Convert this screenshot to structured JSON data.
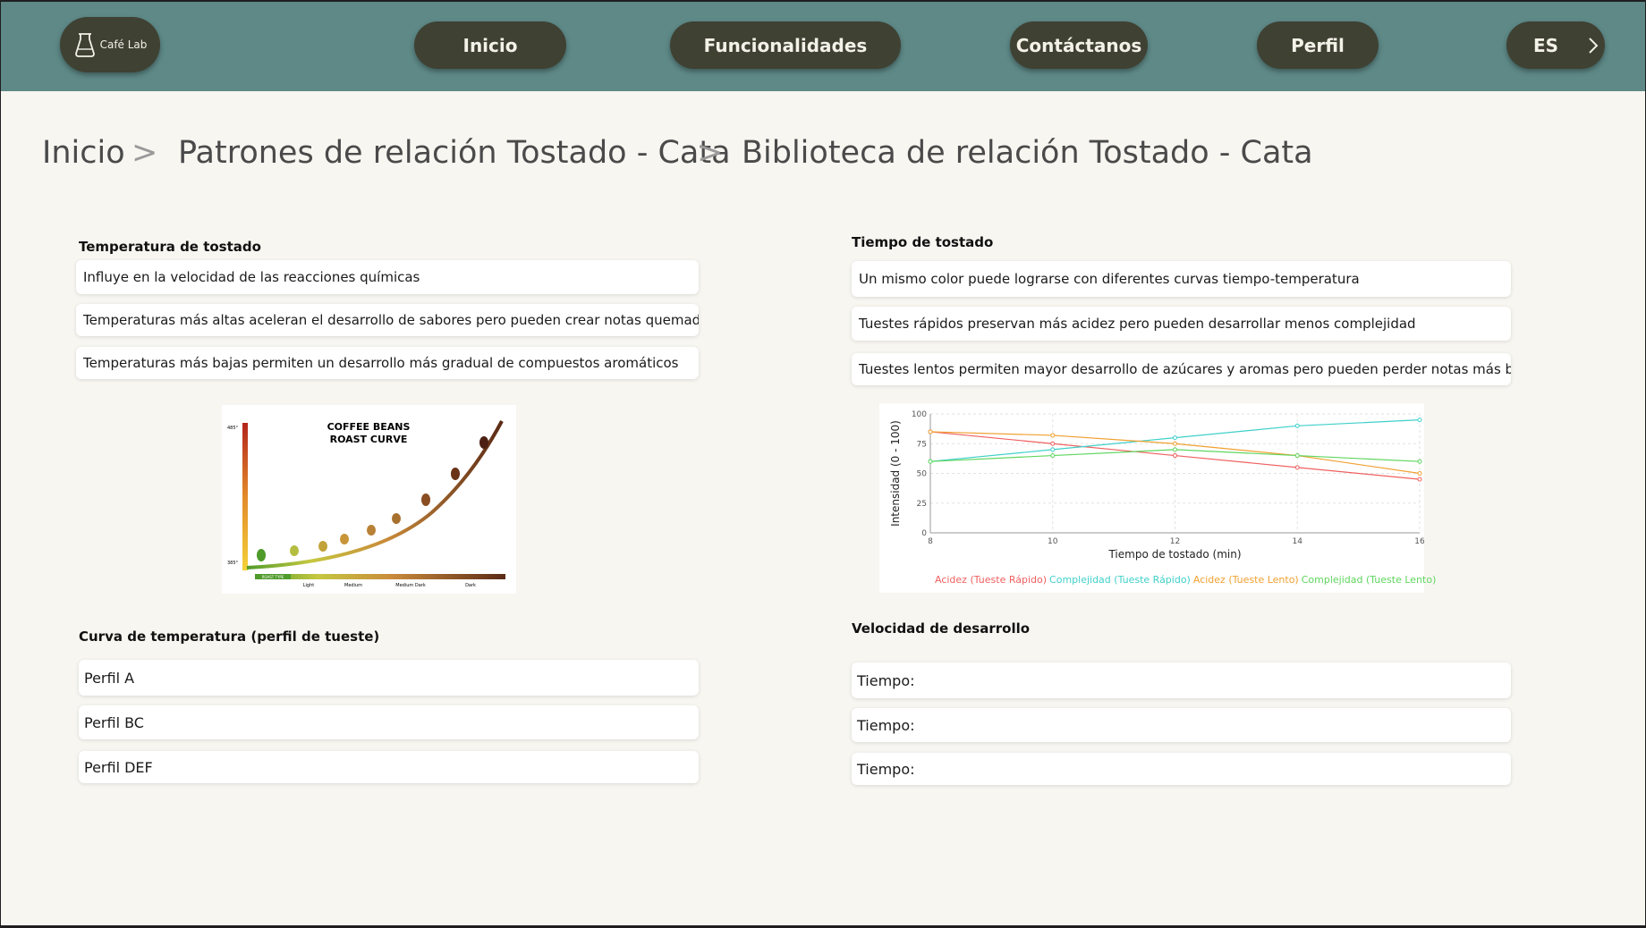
{
  "header": {
    "logo_text": "Café Lab",
    "nav": {
      "inicio": "Inicio",
      "funcionalidades": "Funcionalidades",
      "contactanos": "Contáctanos",
      "perfil": "Perfil",
      "language": "ES"
    }
  },
  "breadcrumb": {
    "items": [
      "Inicio",
      "Patrones de relación Tostado - Cata",
      "Biblioteca de relación Tostado - Cata"
    ],
    "separator": ">"
  },
  "temperatura": {
    "title": "Temperatura de tostado",
    "items": [
      "Influye en la velocidad de las reacciones químicas",
      "Temperaturas más altas aceleran el desarrollo de sabores pero pueden crear notas quemadas",
      "Temperaturas más bajas permiten un desarrollo más gradual de compuestos aromáticos"
    ]
  },
  "roast_image": {
    "title_line1": "COFFEE BEANS",
    "title_line2": "ROAST CURVE",
    "temp_top": "485°",
    "temp_bottom": "385°",
    "bar_labels": [
      "ROAST TYPE",
      "Light",
      "Medium",
      "Medium Dark",
      "Dark"
    ]
  },
  "tiempo": {
    "title": "Tiempo de tostado",
    "items": [
      "Un mismo color puede lograrse con diferentes curvas tiempo-temperatura",
      "Tuestes rápidos preservan más acidez pero pueden desarrollar menos complejidad",
      "Tuestes lentos permiten mayor desarrollo de azúcares y aromas pero pueden perder notas más brillantes"
    ]
  },
  "curva": {
    "title": "Curva de temperatura (perfil de tueste)",
    "items": [
      "Perfil A",
      "Perfil BC",
      "Perfil DEF"
    ]
  },
  "velocidad": {
    "title": "Velocidad de desarrollo",
    "items": [
      "Tiempo:",
      "Tiempo:",
      "Tiempo:"
    ]
  },
  "chart_data": {
    "type": "line",
    "xlabel": "Tiempo de tostado (min)",
    "ylabel": "Intensidad (0 - 100)",
    "x": [
      8,
      10,
      12,
      14,
      16
    ],
    "xticks": [
      "8",
      "10",
      "12",
      "14",
      "16"
    ],
    "yticks": [
      "0",
      "25",
      "50",
      "75",
      "100"
    ],
    "ylim": [
      0,
      100
    ],
    "xlim": [
      8,
      16
    ],
    "grid": true,
    "legend_position": "bottom",
    "series": [
      {
        "name": "Acidez (Tueste Rápido)",
        "color": "#f06060",
        "values": [
          85,
          75,
          65,
          55,
          45
        ]
      },
      {
        "name": "Complejidad (Tueste Rápido)",
        "color": "#3fd0c9",
        "values": [
          60,
          70,
          80,
          90,
          95
        ]
      },
      {
        "name": "Acidez (Tueste Lento)",
        "color": "#f0a030",
        "values": [
          85,
          82,
          75,
          65,
          50
        ]
      },
      {
        "name": "Complejidad (Tueste Lento)",
        "color": "#5fd65f",
        "values": [
          60,
          65,
          70,
          65,
          60
        ]
      }
    ]
  },
  "colors": {
    "header_bg": "#5e8987",
    "button_bg": "#3f4133",
    "page_bg": "#f7f6f1"
  }
}
